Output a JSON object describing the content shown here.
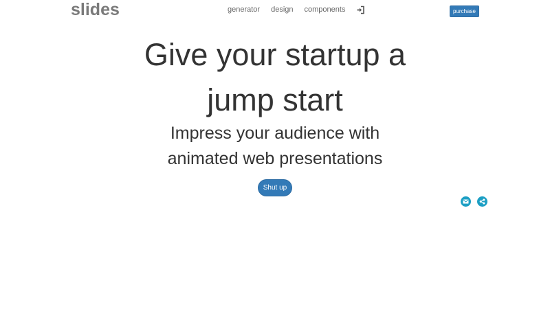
{
  "header": {
    "logo": "slides",
    "nav": [
      {
        "label": "generator"
      },
      {
        "label": "design"
      },
      {
        "label": "components"
      }
    ],
    "login_icon": "sign-in-icon",
    "purchase_label": "purchase"
  },
  "hero": {
    "headline_line1": "Give your startup a",
    "headline_line2": "jump start",
    "subline_line1": "Impress your audience with",
    "subline_line2": "animated web presentations",
    "button_label": "Shut up"
  },
  "share": {
    "icons": [
      "email-icon",
      "share-icon"
    ]
  },
  "colors": {
    "primary": "#337ab7",
    "share_icon_bg": "#1d9fc4",
    "text": "#333333",
    "logo": "#7a7a7a",
    "nav": "#666666"
  }
}
